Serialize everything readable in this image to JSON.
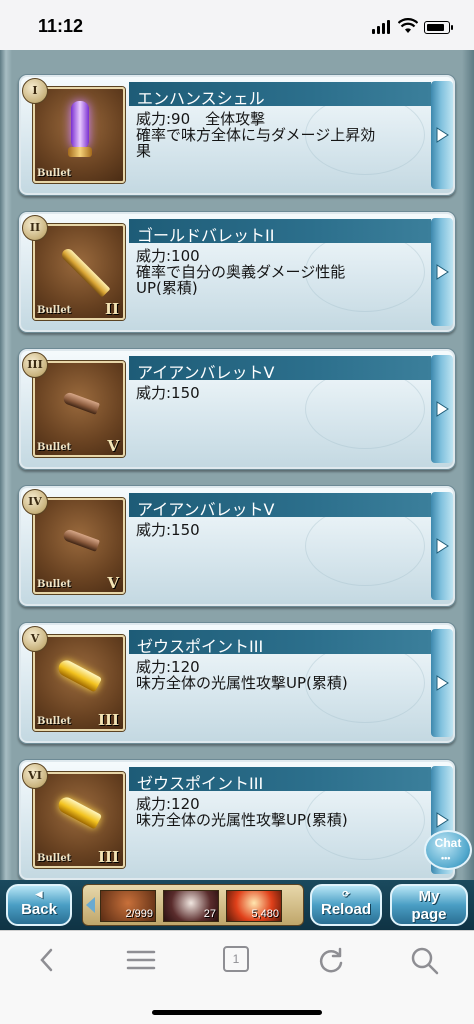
{
  "status_bar": {
    "time": "11:12"
  },
  "bullets": [
    {
      "roman": "I",
      "name": "エンハンスシェル",
      "rank": "",
      "thumb_label": "Bullet",
      "icon": "purple-shell-icon",
      "color": "#b25cff",
      "desc": [
        "威力:90　全体攻撃",
        "確率で味方全体に与ダメージ上昇効",
        "果"
      ]
    },
    {
      "roman": "II",
      "name": "ゴールドバレットII",
      "rank": "II",
      "thumb_label": "Bullet",
      "icon": "gold-bullet-icon",
      "color": "#d9a534",
      "desc": [
        "威力:100",
        "確率で自分の奥義ダメージ性能",
        "UP(累積)"
      ]
    },
    {
      "roman": "III",
      "name": "アイアンバレットV",
      "rank": "V",
      "thumb_label": "Bullet",
      "icon": "iron-bullet-icon",
      "color": "#8a5a3c",
      "desc": [
        "威力:150"
      ]
    },
    {
      "roman": "IV",
      "name": "アイアンバレットV",
      "rank": "V",
      "thumb_label": "Bullet",
      "icon": "iron-bullet-icon",
      "color": "#8a5a3c",
      "desc": [
        "威力:150"
      ]
    },
    {
      "roman": "V",
      "name": "ゼウスポイントIII",
      "rank": "III",
      "thumb_label": "Bullet",
      "icon": "zeus-bullet-icon",
      "color": "#f2c21f",
      "desc": [
        "威力:120",
        "味方全体の光属性攻撃UP(累積)"
      ]
    },
    {
      "roman": "VI",
      "name": "ゼウスポイントIII",
      "rank": "III",
      "thumb_label": "Bullet",
      "icon": "zeus-bullet-icon",
      "color": "#f2c21f",
      "desc": [
        "威力:120",
        "味方全体の光属性攻撃UP(累積)"
      ]
    }
  ],
  "chat": {
    "label": "Chat",
    "dots": "•••"
  },
  "game_bar": {
    "back_label": "Back",
    "reload_label": "Reload",
    "mypage_line1": "My",
    "mypage_line2": "page",
    "items": [
      {
        "count": "2/999",
        "icon": "item-1-icon"
      },
      {
        "count": "27",
        "icon": "item-2-icon"
      },
      {
        "count": "5,480",
        "icon": "item-3-icon"
      }
    ]
  },
  "browser_bar": {
    "tab_count": "1"
  }
}
